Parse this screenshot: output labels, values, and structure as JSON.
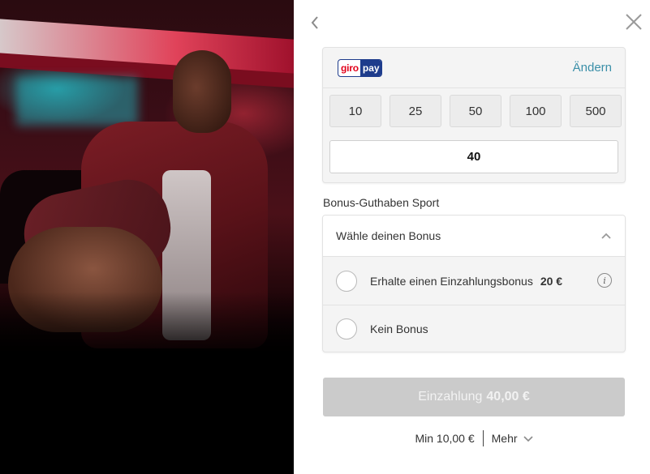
{
  "payment": {
    "method_logo": {
      "part1": "giro",
      "part2": "pay"
    },
    "change_label": "Ändern",
    "preset_amounts": [
      "10",
      "25",
      "50",
      "100",
      "500"
    ],
    "amount_value": "40"
  },
  "bonus": {
    "section_title": "Bonus-Guthaben Sport",
    "header_label": "Wähle deinen Bonus",
    "options": [
      {
        "label": "Erhalte einen Einzahlungsbonus",
        "amount": "20 €"
      },
      {
        "label": "Kein Bonus"
      }
    ]
  },
  "deposit": {
    "label": "Einzahlung",
    "amount": "40,00 €"
  },
  "footer": {
    "min_label": "Min 10,00 €",
    "more_label": "Mehr"
  },
  "colors": {
    "accent_link": "#3a8fa8",
    "button_disabled": "#cbcbcb",
    "giropay_blue": "#1e3c8c",
    "giropay_red": "#e2001a"
  },
  "icons": [
    "back-arrow-icon",
    "close-icon",
    "chevron-up-icon",
    "info-icon",
    "chevron-down-icon"
  ]
}
